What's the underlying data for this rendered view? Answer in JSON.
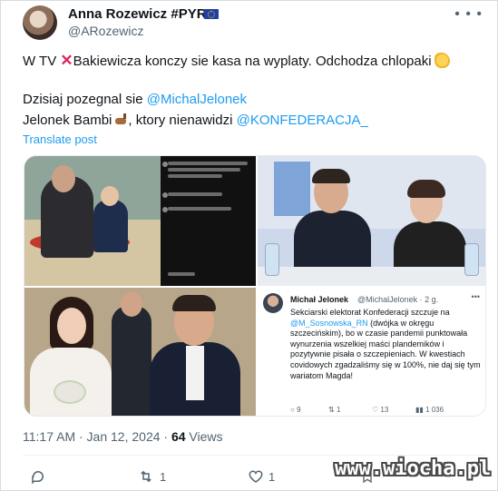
{
  "author": {
    "name": "Anna Rozewicz #PYRA",
    "handle": "@ARozewicz",
    "badge_icon": "eu-flag-icon"
  },
  "tweet": {
    "line1_before": "W TV ",
    "line1_after": "Bakiewicza konczy sie kasa na wyplaty. Odchodza chlopaki",
    "line2_before": "Dzisiaj pozegnal sie ",
    "line2_mention": "@MichalJelonek",
    "line3_before": "Jelonek Bambi",
    "line3_middle": ", ktory nienawidzi ",
    "line3_mention": "@KONFEDERACJA_",
    "translate_label": "Translate post"
  },
  "quoted": {
    "name": "Michał Jelonek",
    "handle": "@MichalJelonek · 2 g.",
    "text_before": "Sekciarski elektorat Konfederacji szczuje na ",
    "text_mention": "@M_Sosnowska_RN",
    "text_after": " (dwójka w okręgu szczecińskim), bo w czasie pandemii punktowała wynurzenia wszelkiej maści plandemików i pozytywnie pisała o szczepieniach. W kwestiach covidowych zgadzaliśmy się w 100%, nie daj się tym wariatom Magda!",
    "replies": "9",
    "retweets": "1",
    "likes": "13",
    "views": "1 036"
  },
  "meta": {
    "time_date": "11:17 AM · Jan 12, 2024 · ",
    "views_count": "64",
    "views_label": " Views"
  },
  "actions": {
    "reply_count": "",
    "retweet_count": "1",
    "like_count": "1",
    "bookmark_count": ""
  },
  "watermark": "www.wiocha.pl",
  "colors": {
    "accent": "#1d9bf0",
    "text": "#0f1419",
    "secondary": "#536471",
    "red_x": "#e0245e"
  }
}
